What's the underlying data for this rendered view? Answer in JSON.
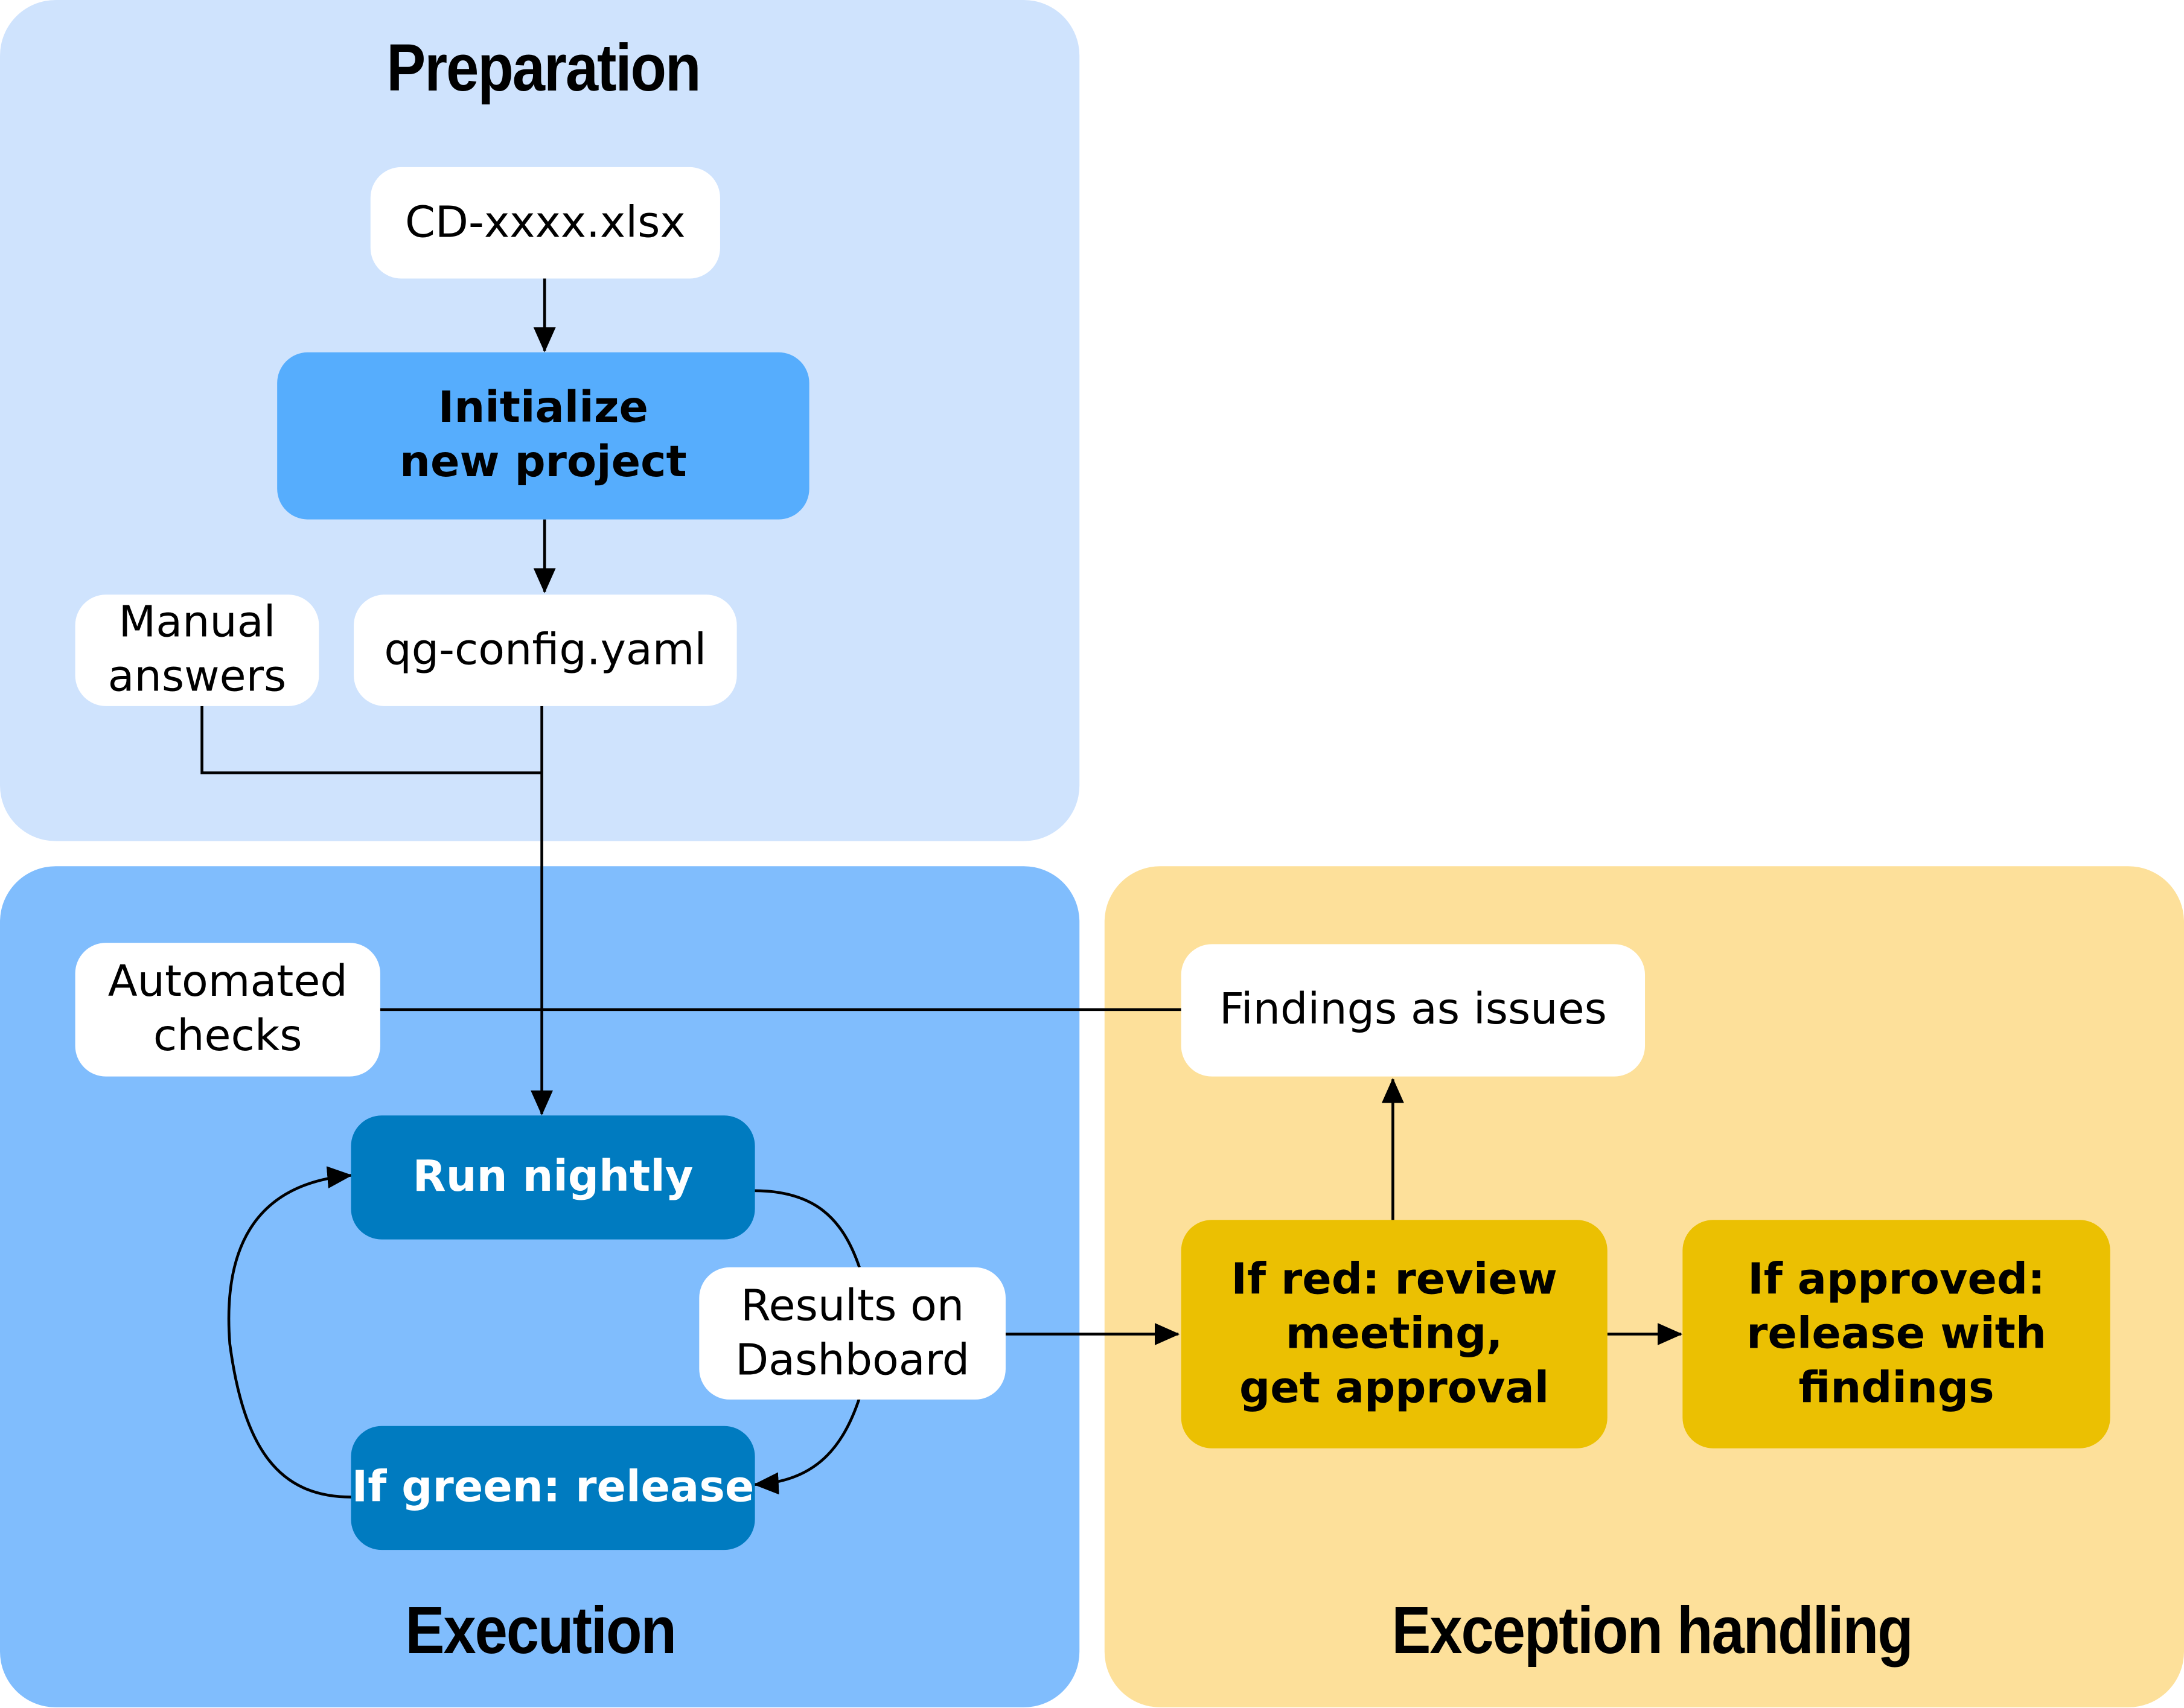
{
  "colors": {
    "preparation_bg": "#cfe3fd",
    "execution_bg": "#80bdfd",
    "exception_bg": "#fde09a",
    "initialize_box": "#56adfd",
    "execution_box": "#007bc0",
    "exception_box": "#ebc002",
    "white_box": "#ffffff"
  },
  "panels": {
    "preparation": {
      "title": "Preparation"
    },
    "execution": {
      "title": "Execution"
    },
    "exception": {
      "title": "Exception handling"
    }
  },
  "nodes": {
    "cd_file": "CD-xxxx.xlsx",
    "initialize": "Initialize\nnew project",
    "manual_answers": "Manual\nanswers",
    "qg_config": "qg-config.yaml",
    "automated_checks": "Automated\nchecks",
    "run_nightly": "Run nightly",
    "results_dashboard": "Results on\nDashboard",
    "if_green": "If green: release",
    "findings_issues": "Findings as issues",
    "if_red": "If red: review\nmeeting,\nget approval",
    "if_approved": "If approved:\nrelease with\nfindings"
  }
}
